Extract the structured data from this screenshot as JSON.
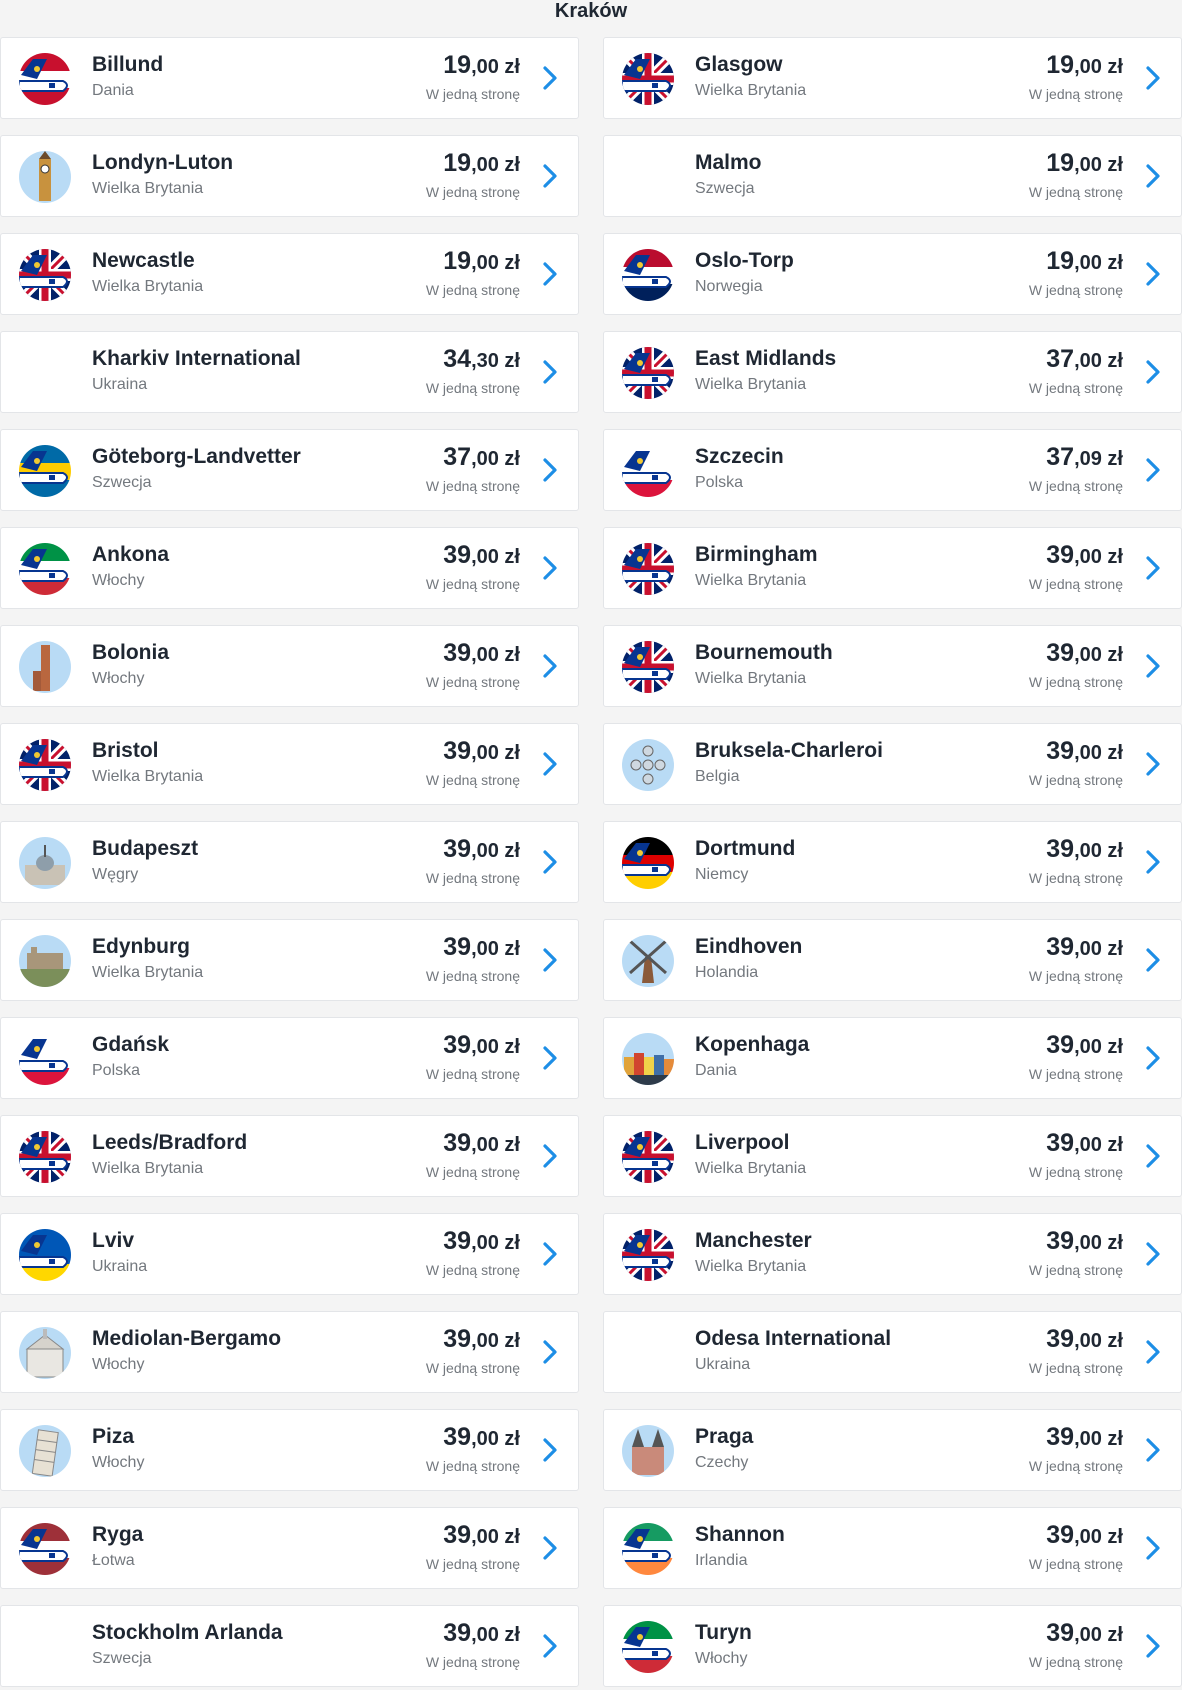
{
  "header": {
    "title": "Kraków"
  },
  "colors": {
    "accent": "#1d8ee6",
    "text": "#1f2732",
    "muted": "#73787e"
  },
  "destinations": [
    {
      "name": "Billund",
      "country": "Dania",
      "price_int": "19",
      "price_dec": ",00",
      "currency": " zł",
      "note": "W jedną stronę",
      "icon": "ryanair-tail-denmark-icon"
    },
    {
      "name": "Glasgow",
      "country": "Wielka Brytania",
      "price_int": "19",
      "price_dec": ",00",
      "currency": " zł",
      "note": "W jedną stronę",
      "icon": "ryanair-tail-uk-icon"
    },
    {
      "name": "Londyn-Luton",
      "country": "Wielka Brytania",
      "price_int": "19",
      "price_dec": ",00",
      "currency": " zł",
      "note": "W jedną stronę",
      "icon": "big-ben-icon"
    },
    {
      "name": "Malmo",
      "country": "Szwecja",
      "price_int": "19",
      "price_dec": ",00",
      "currency": " zł",
      "note": "W jedną stronę",
      "icon": ""
    },
    {
      "name": "Newcastle",
      "country": "Wielka Brytania",
      "price_int": "19",
      "price_dec": ",00",
      "currency": " zł",
      "note": "W jedną stronę",
      "icon": "ryanair-tail-uk-icon"
    },
    {
      "name": "Oslo-Torp",
      "country": "Norwegia",
      "price_int": "19",
      "price_dec": ",00",
      "currency": " zł",
      "note": "W jedną stronę",
      "icon": "ryanair-tail-norway-icon"
    },
    {
      "name": "Kharkiv International",
      "country": "Ukraina",
      "price_int": "34",
      "price_dec": ",30",
      "currency": " zł",
      "note": "W jedną stronę",
      "icon": ""
    },
    {
      "name": "East Midlands",
      "country": "Wielka Brytania",
      "price_int": "37",
      "price_dec": ",00",
      "currency": " zł",
      "note": "W jedną stronę",
      "icon": "ryanair-tail-uk-icon"
    },
    {
      "name": "Göteborg-Landvetter",
      "country": "Szwecja",
      "price_int": "37",
      "price_dec": ",00",
      "currency": " zł",
      "note": "W jedną stronę",
      "icon": "ryanair-tail-sweden-icon"
    },
    {
      "name": "Szczecin",
      "country": "Polska",
      "price_int": "37",
      "price_dec": ",09",
      "currency": " zł",
      "note": "W jedną stronę",
      "icon": "ryanair-tail-poland-icon"
    },
    {
      "name": "Ankona",
      "country": "Włochy",
      "price_int": "39",
      "price_dec": ",00",
      "currency": " zł",
      "note": "W jedną stronę",
      "icon": "ryanair-tail-italy-icon"
    },
    {
      "name": "Birmingham",
      "country": "Wielka Brytania",
      "price_int": "39",
      "price_dec": ",00",
      "currency": " zł",
      "note": "W jedną stronę",
      "icon": "ryanair-tail-uk-icon"
    },
    {
      "name": "Bolonia",
      "country": "Włochy",
      "price_int": "39",
      "price_dec": ",00",
      "currency": " zł",
      "note": "W jedną stronę",
      "icon": "bologna-tower-icon"
    },
    {
      "name": "Bournemouth",
      "country": "Wielka Brytania",
      "price_int": "39",
      "price_dec": ",00",
      "currency": " zł",
      "note": "W jedną stronę",
      "icon": "ryanair-tail-uk-icon"
    },
    {
      "name": "Bristol",
      "country": "Wielka Brytania",
      "price_int": "39",
      "price_dec": ",00",
      "currency": " zł",
      "note": "W jedną stronę",
      "icon": "ryanair-tail-uk-icon"
    },
    {
      "name": "Bruksela-Charleroi",
      "country": "Belgia",
      "price_int": "39",
      "price_dec": ",00",
      "currency": " zł",
      "note": "W jedną stronę",
      "icon": "atomium-icon"
    },
    {
      "name": "Budapeszt",
      "country": "Węgry",
      "price_int": "39",
      "price_dec": ",00",
      "currency": " zł",
      "note": "W jedną stronę",
      "icon": "parliament-icon"
    },
    {
      "name": "Dortmund",
      "country": "Niemcy",
      "price_int": "39",
      "price_dec": ",00",
      "currency": " zł",
      "note": "W jedną stronę",
      "icon": "ryanair-tail-germany-icon"
    },
    {
      "name": "Edynburg",
      "country": "Wielka Brytania",
      "price_int": "39",
      "price_dec": ",00",
      "currency": " zł",
      "note": "W jedną stronę",
      "icon": "edinburgh-castle-icon"
    },
    {
      "name": "Eindhoven",
      "country": "Holandia",
      "price_int": "39",
      "price_dec": ",00",
      "currency": " zł",
      "note": "W jedną stronę",
      "icon": "windmill-icon"
    },
    {
      "name": "Gdańsk",
      "country": "Polska",
      "price_int": "39",
      "price_dec": ",00",
      "currency": " zł",
      "note": "W jedną stronę",
      "icon": "ryanair-tail-poland-icon"
    },
    {
      "name": "Kopenhaga",
      "country": "Dania",
      "price_int": "39",
      "price_dec": ",00",
      "currency": " zł",
      "note": "W jedną stronę",
      "icon": "nyhavn-houses-icon"
    },
    {
      "name": "Leeds/Bradford",
      "country": "Wielka Brytania",
      "price_int": "39",
      "price_dec": ",00",
      "currency": " zł",
      "note": "W jedną stronę",
      "icon": "ryanair-tail-uk-icon"
    },
    {
      "name": "Liverpool",
      "country": "Wielka Brytania",
      "price_int": "39",
      "price_dec": ",00",
      "currency": " zł",
      "note": "W jedną stronę",
      "icon": "ryanair-tail-uk-icon"
    },
    {
      "name": "Lviv",
      "country": "Ukraina",
      "price_int": "39",
      "price_dec": ",00",
      "currency": " zł",
      "note": "W jedną stronę",
      "icon": "ryanair-tail-ukraine-icon"
    },
    {
      "name": "Manchester",
      "country": "Wielka Brytania",
      "price_int": "39",
      "price_dec": ",00",
      "currency": " zł",
      "note": "W jedną stronę",
      "icon": "ryanair-tail-uk-icon"
    },
    {
      "name": "Mediolan-Bergamo",
      "country": "Włochy",
      "price_int": "39",
      "price_dec": ",00",
      "currency": " zł",
      "note": "W jedną stronę",
      "icon": "milan-cathedral-icon"
    },
    {
      "name": "Odesa International",
      "country": "Ukraina",
      "price_int": "39",
      "price_dec": ",00",
      "currency": " zł",
      "note": "W jedną stronę",
      "icon": ""
    },
    {
      "name": "Piza",
      "country": "Włochy",
      "price_int": "39",
      "price_dec": ",00",
      "currency": " zł",
      "note": "W jedną stronę",
      "icon": "leaning-tower-icon"
    },
    {
      "name": "Praga",
      "country": "Czechy",
      "price_int": "39",
      "price_dec": ",00",
      "currency": " zł",
      "note": "W jedną stronę",
      "icon": "tyn-church-icon"
    },
    {
      "name": "Ryga",
      "country": "Łotwa",
      "price_int": "39",
      "price_dec": ",00",
      "currency": " zł",
      "note": "W jedną stronę",
      "icon": "ryanair-tail-latvia-icon"
    },
    {
      "name": "Shannon",
      "country": "Irlandia",
      "price_int": "39",
      "price_dec": ",00",
      "currency": " zł",
      "note": "W jedną stronę",
      "icon": "ryanair-tail-ireland-icon"
    },
    {
      "name": "Stockholm Arlanda",
      "country": "Szwecja",
      "price_int": "39",
      "price_dec": ",00",
      "currency": " zł",
      "note": "W jedną stronę",
      "icon": ""
    },
    {
      "name": "Turyn",
      "country": "Włochy",
      "price_int": "39",
      "price_dec": ",00",
      "currency": " zł",
      "note": "W jedną stronę",
      "icon": "ryanair-tail-italy-icon"
    }
  ]
}
